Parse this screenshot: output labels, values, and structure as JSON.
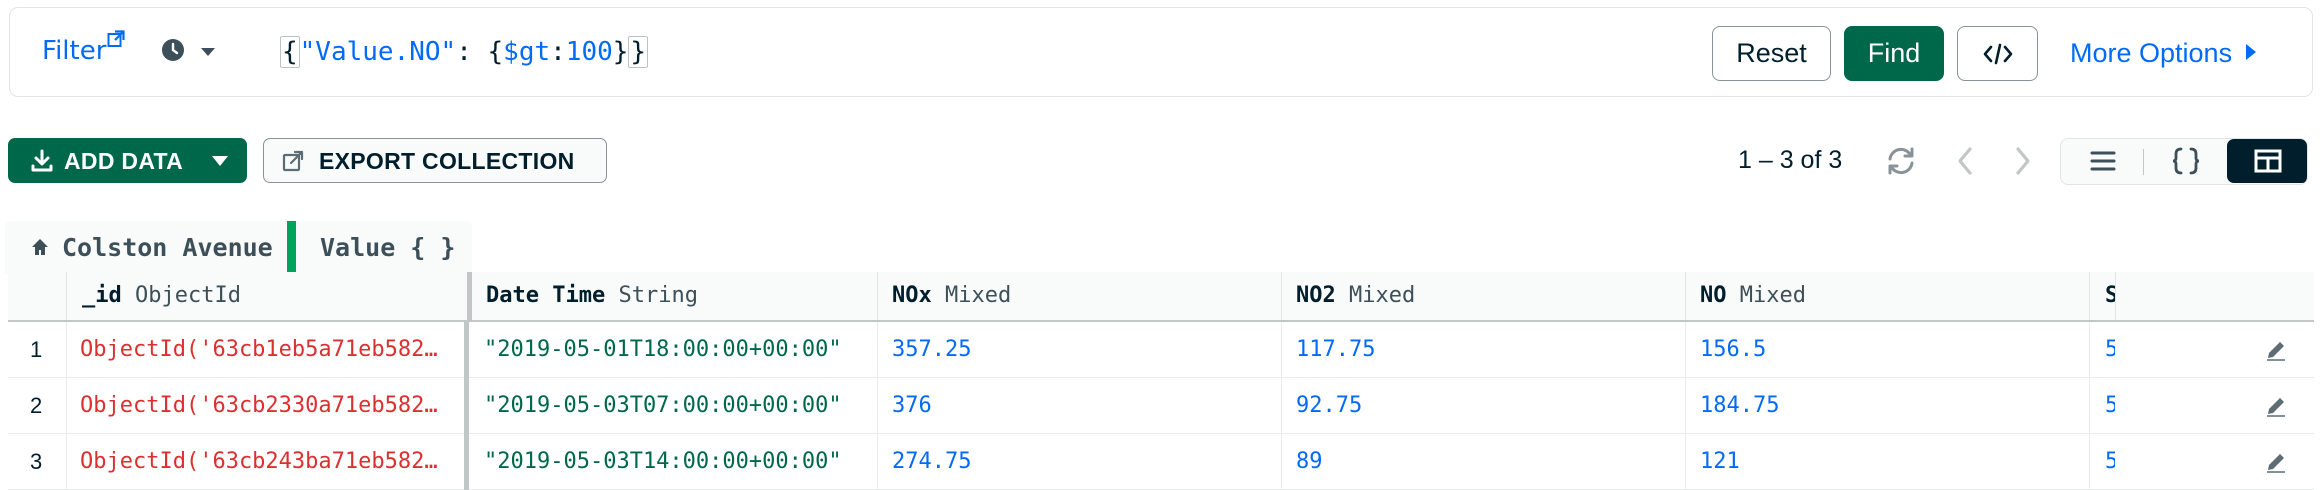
{
  "query_bar": {
    "filter_label": "Filter",
    "filter_ext_icon": "external-link-icon",
    "history_icon": "clock-icon",
    "query_parts": {
      "open_brace": "{",
      "key": "\"Value.NO\"",
      "colon": ": ",
      "inner_open": "{",
      "operator": "$gt",
      "op_colon": ":",
      "number": "100",
      "inner_close": "}",
      "close_brace": "}"
    },
    "reset_label": "Reset",
    "find_label": "Find",
    "code_icon": "code-brackets-icon",
    "more_options_label": "More Options"
  },
  "toolbar": {
    "add_data_label": "ADD DATA",
    "export_label": "EXPORT COLLECTION",
    "pagination_text": "1 – 3 of 3",
    "refresh_icon": "refresh-icon",
    "prev_icon": "chevron-left-icon",
    "next_icon": "chevron-right-icon",
    "views": [
      "list-view-icon",
      "json-view-icon",
      "table-view-icon"
    ],
    "active_view": "table"
  },
  "breadcrumb": {
    "root": "Colston Avenue",
    "current": "Value { }"
  },
  "table": {
    "columns": [
      {
        "name": "_id",
        "type": "ObjectId"
      },
      {
        "name": "Date Time",
        "type": "String"
      },
      {
        "name": "NOx",
        "type": "Mixed"
      },
      {
        "name": "NO2",
        "type": "Mixed"
      },
      {
        "name": "NO",
        "type": "Mixed"
      },
      {
        "name": "S",
        "type": ""
      }
    ],
    "rows": [
      {
        "index": "1",
        "id": "ObjectId('63cb1eb5a71eb582…",
        "datetime": "\"2019-05-01T18:00:00+00:00\"",
        "nox": "357.25",
        "no2": "117.75",
        "no": "156.5",
        "s": "5"
      },
      {
        "index": "2",
        "id": "ObjectId('63cb2330a71eb582…",
        "datetime": "\"2019-05-03T07:00:00+00:00\"",
        "nox": "376",
        "no2": "92.75",
        "no": "184.75",
        "s": "5"
      },
      {
        "index": "3",
        "id": "ObjectId('63cb243ba71eb582…",
        "datetime": "\"2019-05-03T14:00:00+00:00\"",
        "nox": "274.75",
        "no2": "89",
        "no": "121",
        "s": "5"
      }
    ]
  },
  "colors": {
    "accent": "#016bf8",
    "brand_green": "#00684a",
    "objectid_red": "#db3030",
    "dark": "#001e2b"
  }
}
